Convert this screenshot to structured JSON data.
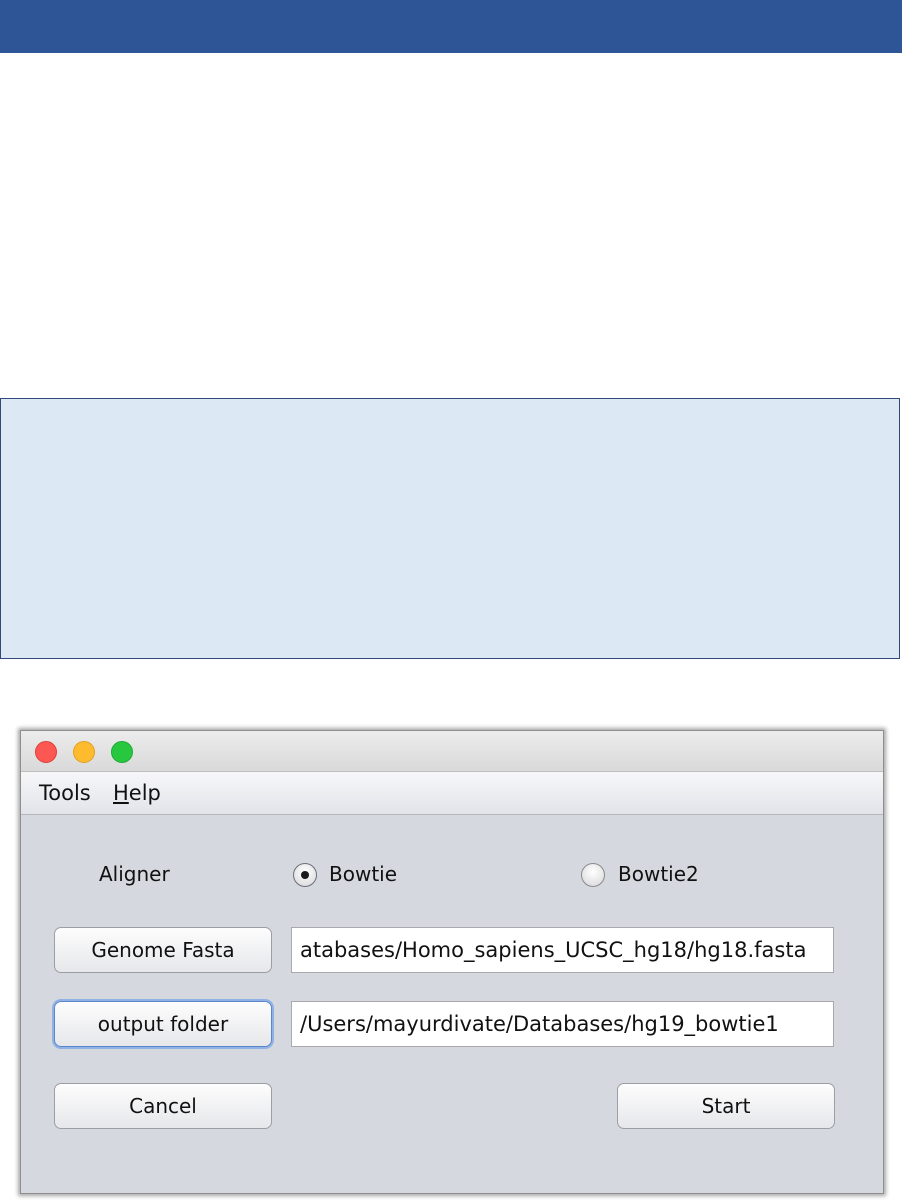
{
  "menu": {
    "tools_label": "Tools",
    "help_label_first": "H",
    "help_label_rest": "elp"
  },
  "aligner": {
    "label": "Aligner",
    "options": [
      {
        "label": "Bowtie",
        "selected": true
      },
      {
        "label": "Bowtie2",
        "selected": false
      }
    ]
  },
  "genome": {
    "button_label": "Genome Fasta",
    "value": "atabases/Homo_sapiens_UCSC_hg18/hg18.fasta"
  },
  "output": {
    "button_label": "output folder",
    "value": "/Users/mayurdivate/Databases/hg19_bowtie1"
  },
  "actions": {
    "cancel_label": "Cancel",
    "start_label": "Start"
  },
  "colors": {
    "banner": "#2e5596",
    "note_box": "#dde8f5",
    "window_bg": "#d6d8df",
    "close": "#fc5753",
    "minimize": "#fdbb2d",
    "zoom": "#27c840"
  }
}
